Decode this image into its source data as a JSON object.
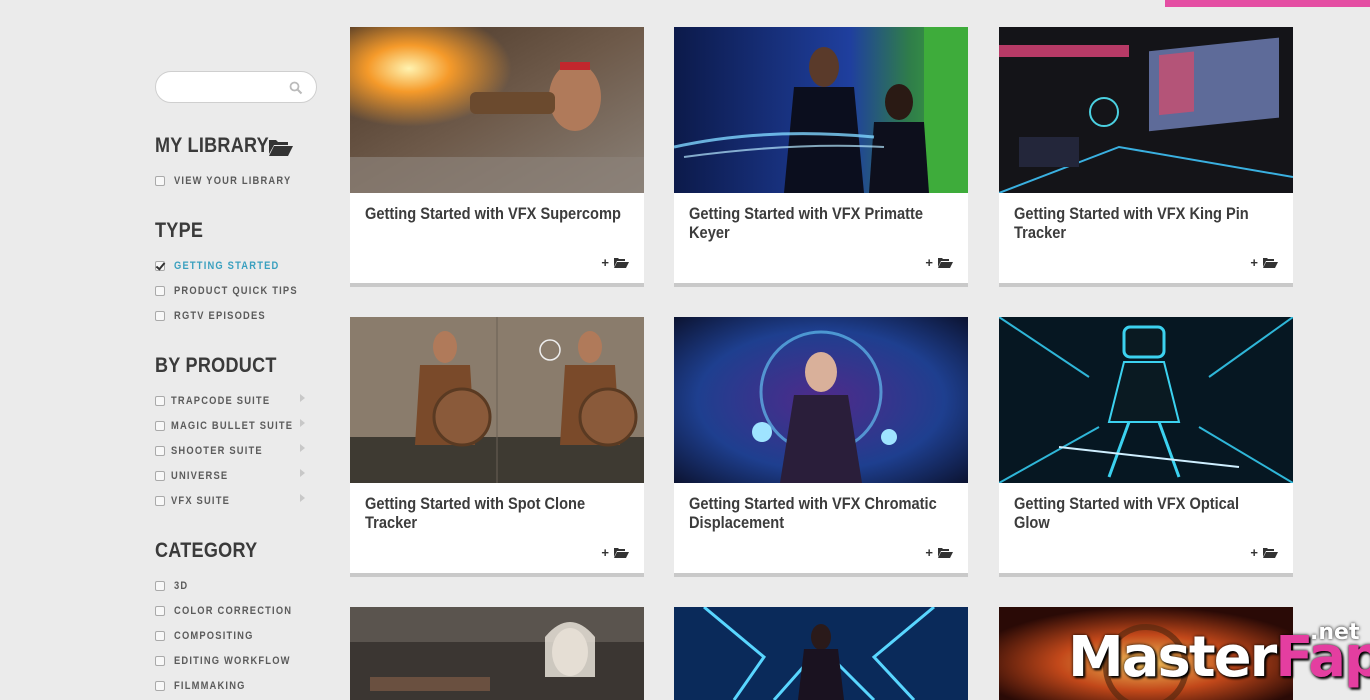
{
  "sidebar": {
    "search": {
      "placeholder": ""
    },
    "my_library": {
      "title": "MY LIBRARY",
      "items": [
        {
          "label": "VIEW YOUR LIBRARY",
          "checked": false
        }
      ]
    },
    "type": {
      "title": "TYPE",
      "items": [
        {
          "label": "GETTING STARTED",
          "checked": true
        },
        {
          "label": "PRODUCT QUICK TIPS",
          "checked": false
        },
        {
          "label": "RGTV EPISODES",
          "checked": false
        }
      ]
    },
    "by_product": {
      "title": "BY PRODUCT",
      "items": [
        {
          "label": "TRAPCODE SUITE",
          "checked": false
        },
        {
          "label": "MAGIC BULLET SUITE",
          "checked": false
        },
        {
          "label": "SHOOTER SUITE",
          "checked": false
        },
        {
          "label": "UNIVERSE",
          "checked": false
        },
        {
          "label": "VFX SUITE",
          "checked": false
        }
      ]
    },
    "category": {
      "title": "CATEGORY",
      "items": [
        {
          "label": "3D",
          "checked": false
        },
        {
          "label": "COLOR CORRECTION",
          "checked": false
        },
        {
          "label": "COMPOSITING",
          "checked": false
        },
        {
          "label": "EDITING WORKFLOW",
          "checked": false
        },
        {
          "label": "FILMMAKING",
          "checked": false
        }
      ]
    }
  },
  "cards": [
    {
      "title": "Getting Started with VFX Supercomp",
      "add_label": "+"
    },
    {
      "title": "Getting Started with VFX Primatte Keyer",
      "add_label": "+"
    },
    {
      "title": "Getting Started with VFX King Pin Tracker",
      "add_label": "+"
    },
    {
      "title": "Getting Started with Spot Clone Tracker",
      "add_label": "+"
    },
    {
      "title": "Getting Started with VFX Chromatic Displacement",
      "add_label": "+"
    },
    {
      "title": "Getting Started with VFX Optical Glow",
      "add_label": "+"
    }
  ],
  "watermark": {
    "master": "Master",
    "fap": "Fap",
    "net": ".net"
  },
  "colors": {
    "accent_pink": "#e44ea3",
    "active_filter": "#3aa0bf"
  }
}
